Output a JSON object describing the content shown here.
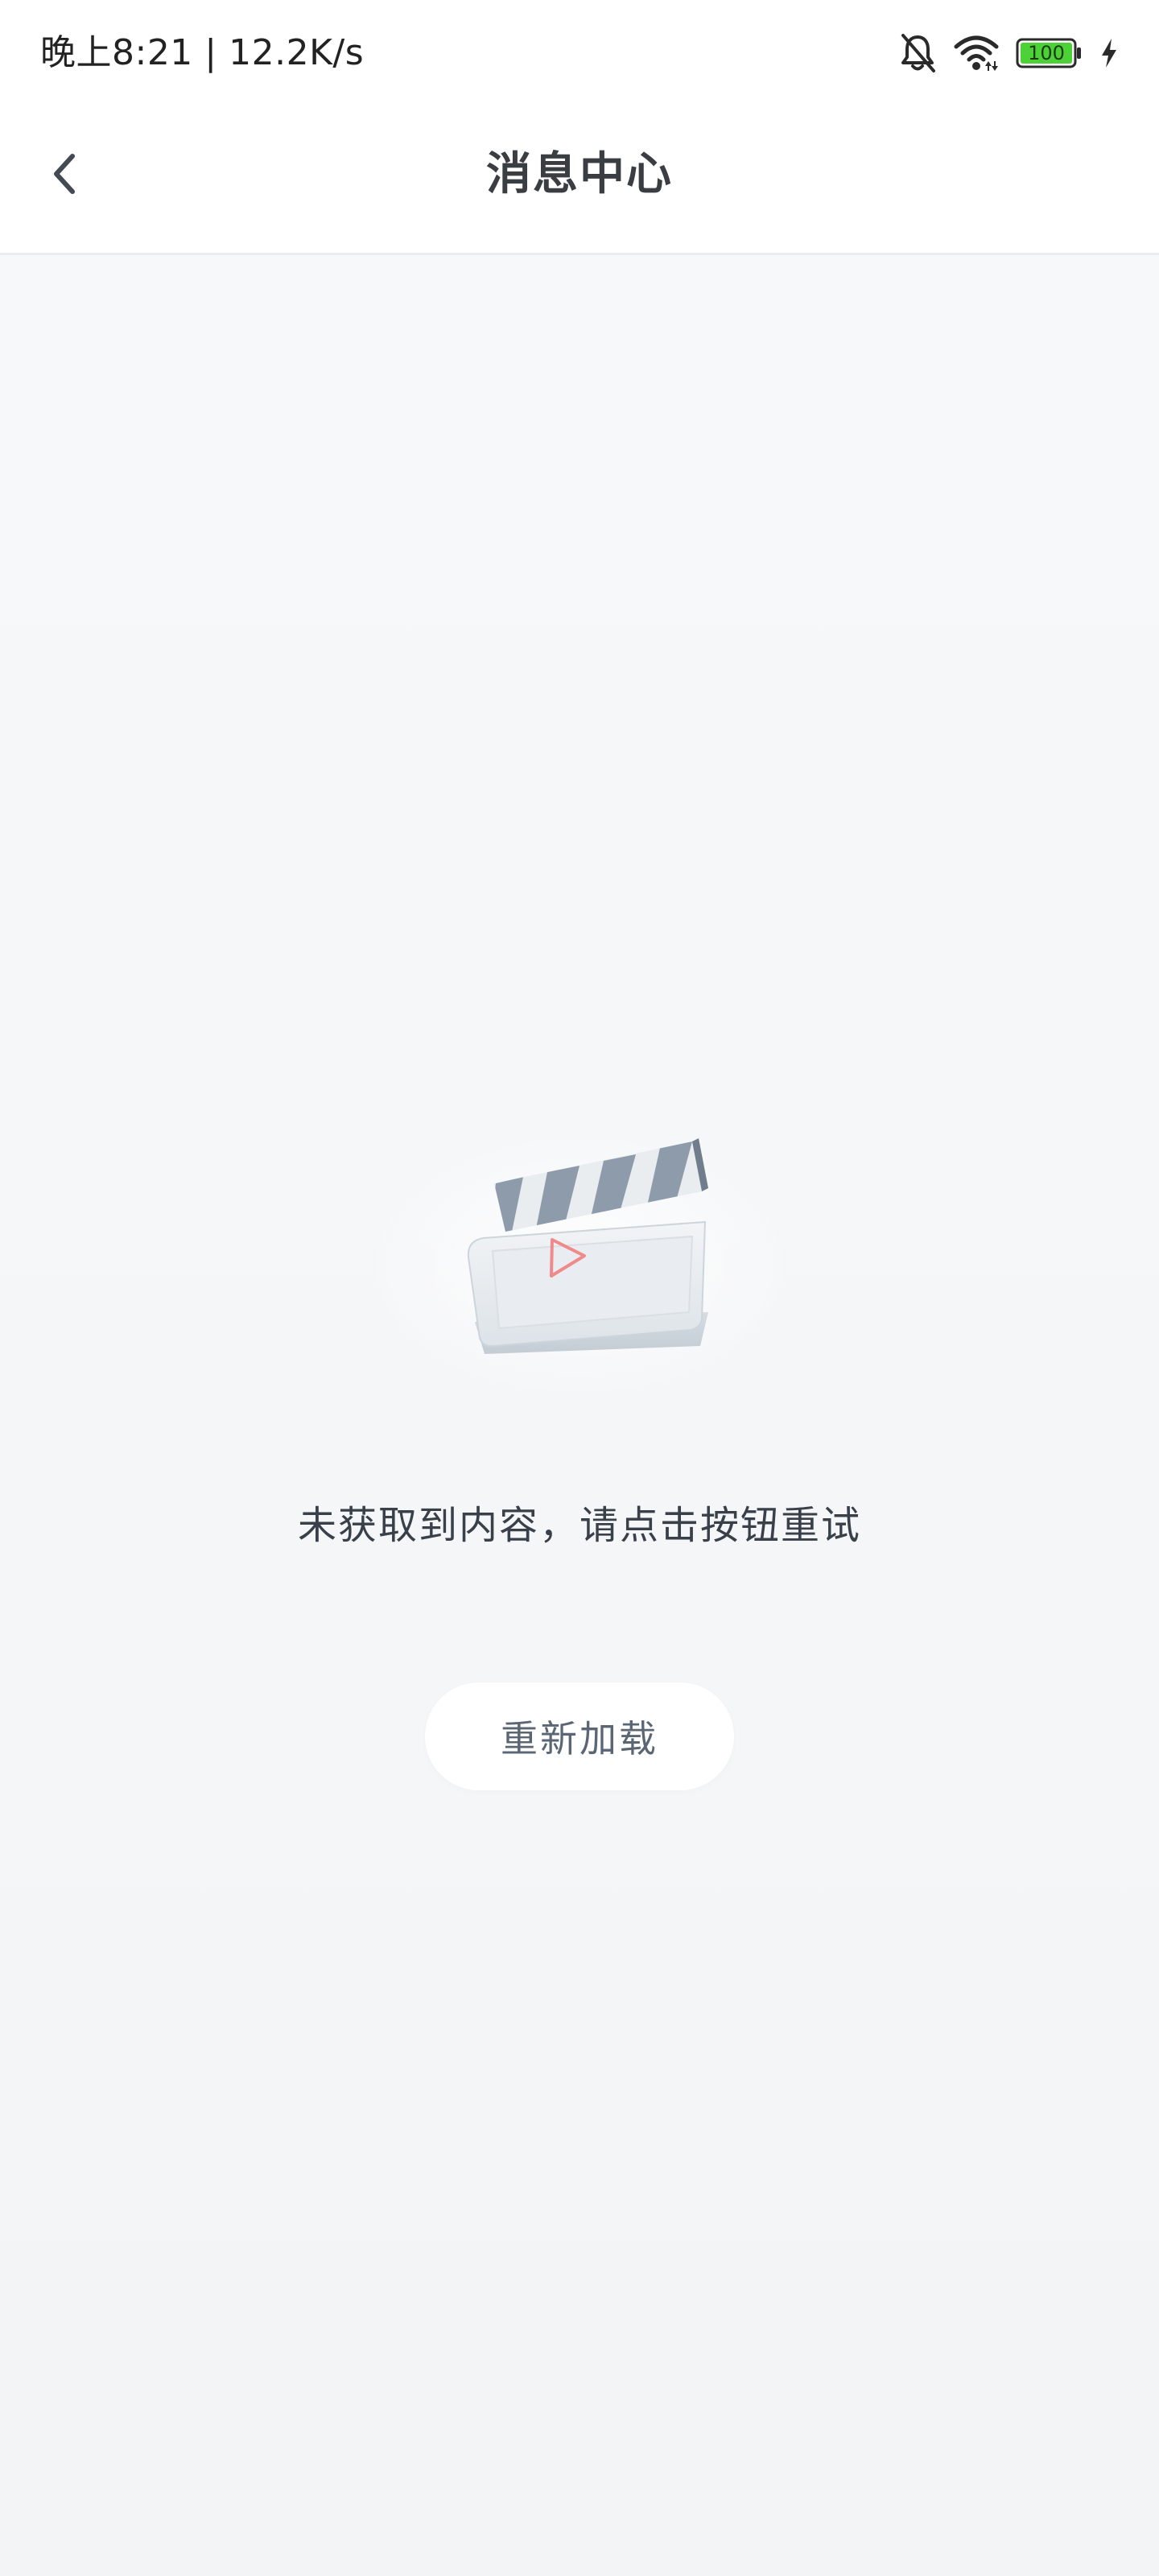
{
  "status_bar": {
    "time_speed": "晚上8:21 | 12.2K/s",
    "battery_level": "100",
    "icons": [
      "bell-off-icon",
      "wifi-icon",
      "battery-icon",
      "charging-icon"
    ]
  },
  "header": {
    "title": "消息中心",
    "back_icon": "chevron-left-icon"
  },
  "empty_state": {
    "illustration": "clapperboard-icon",
    "message": "未获取到内容，请点击按钮重试",
    "reload_label": "重新加载"
  },
  "colors": {
    "battery_fill": "#4cd137",
    "play_accent": "#f08a8a",
    "clapper_stripe": "#8e9baa"
  }
}
